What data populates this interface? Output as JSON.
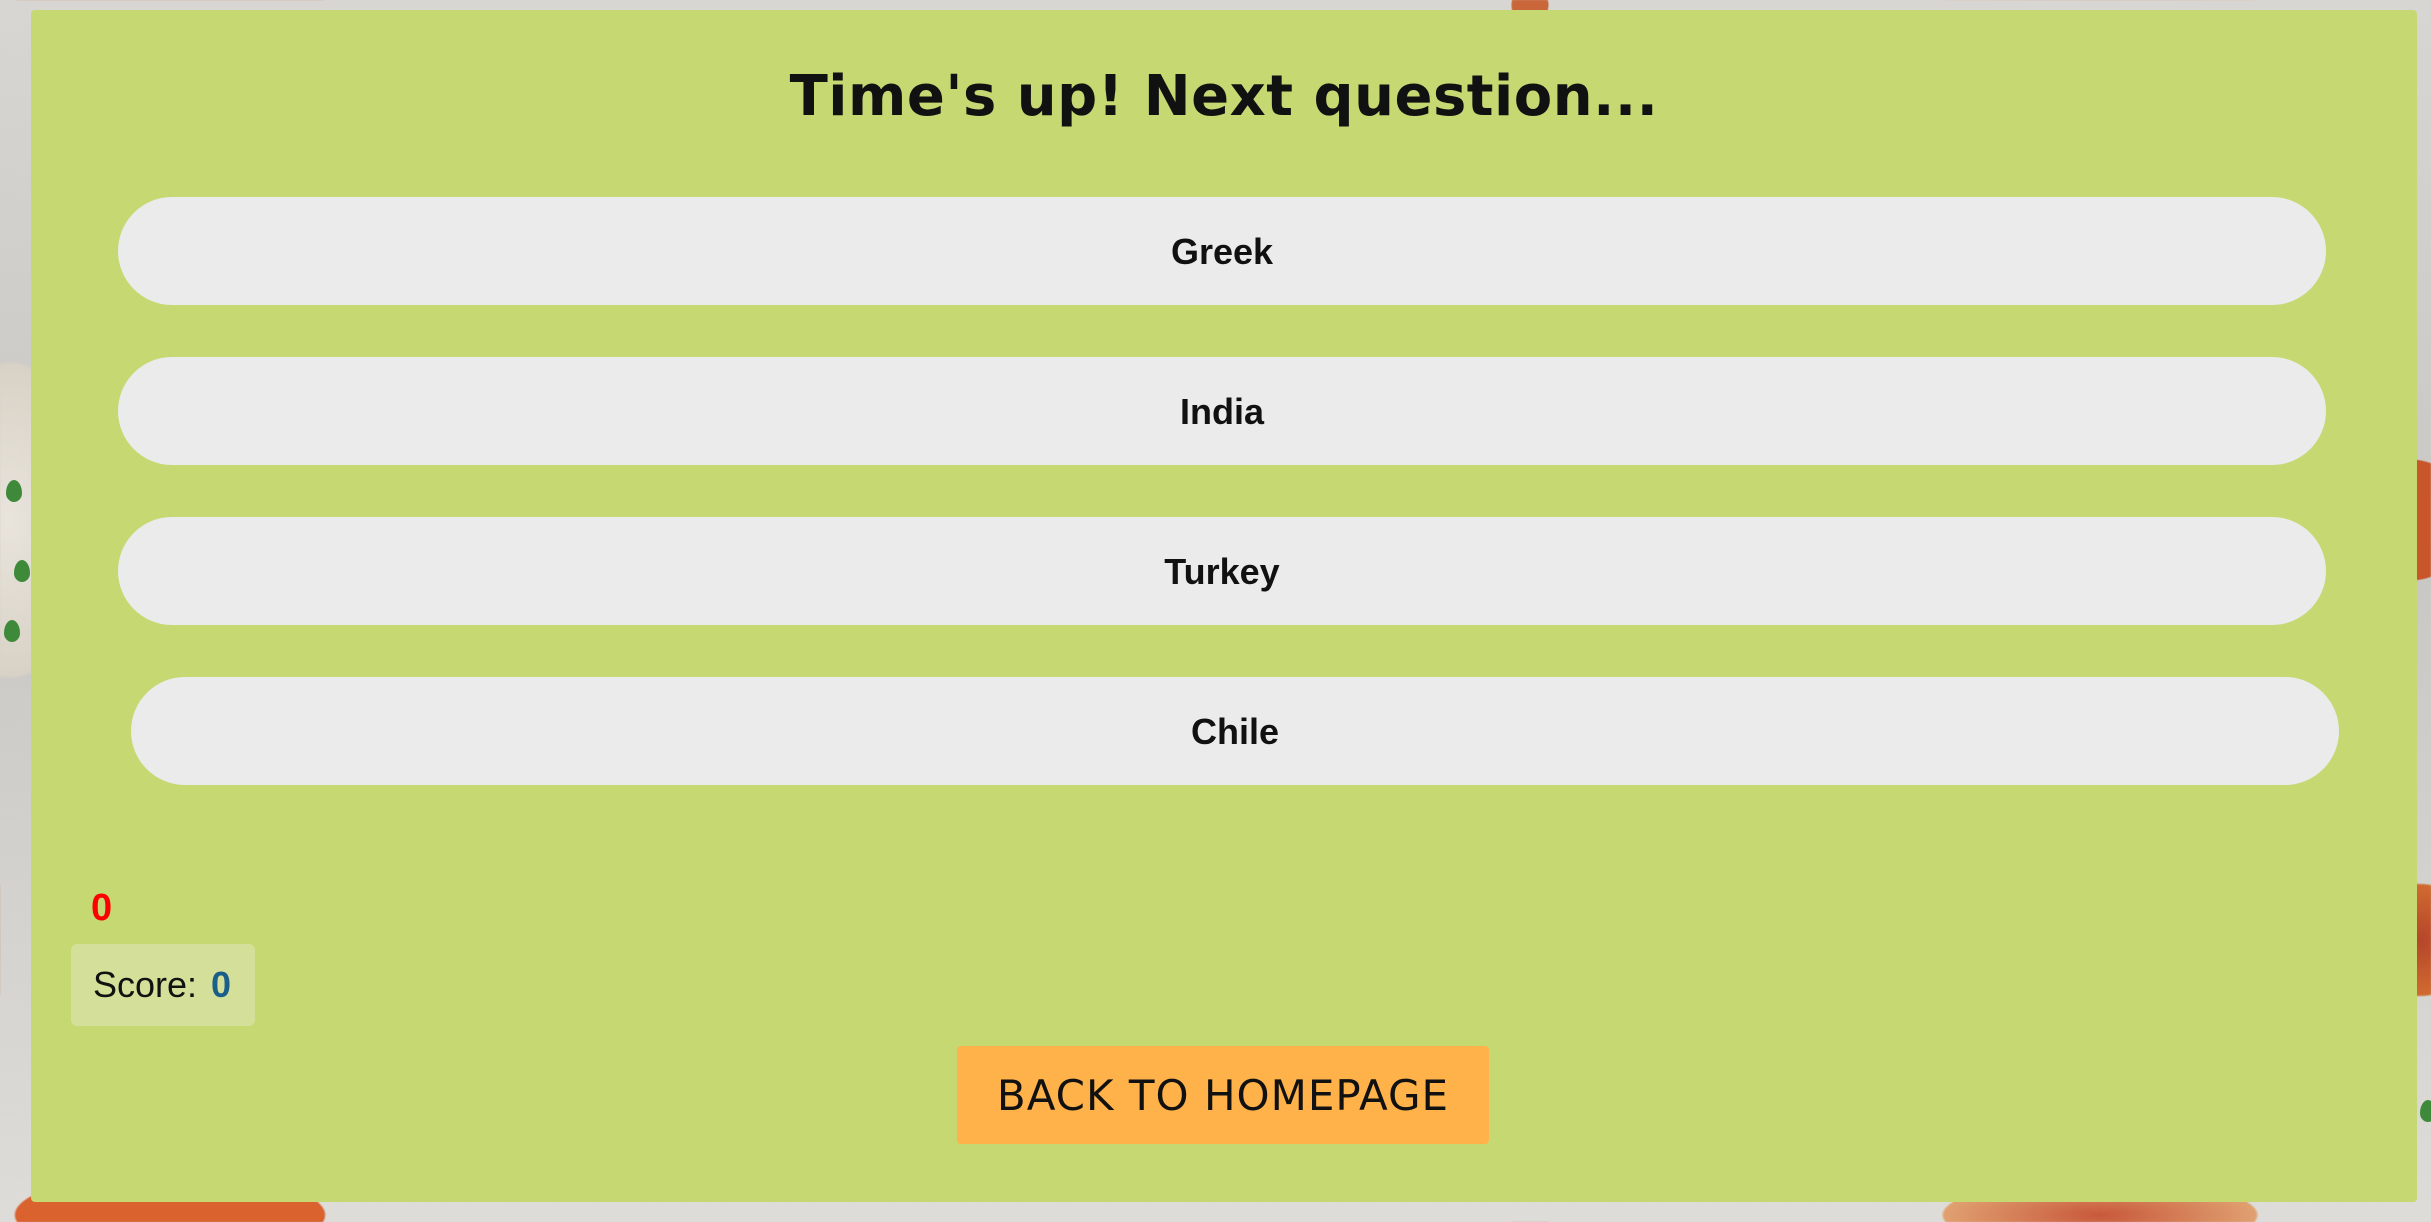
{
  "quiz": {
    "status_message": "Time's up! Next question...",
    "answers": [
      {
        "label": "Greek"
      },
      {
        "label": "India"
      },
      {
        "label": "Turkey"
      },
      {
        "label": "Chile"
      }
    ],
    "timer_value": "0",
    "score_label": "Score:",
    "score_value": "0",
    "back_button_label": "BACK TO HOMEPAGE"
  },
  "colors": {
    "panel_background": "#c6d872",
    "answer_background": "#ebebeb",
    "timer_color": "#ff0000",
    "score_value_color": "#1a5e8a",
    "back_button_background": "#ffb24a"
  }
}
